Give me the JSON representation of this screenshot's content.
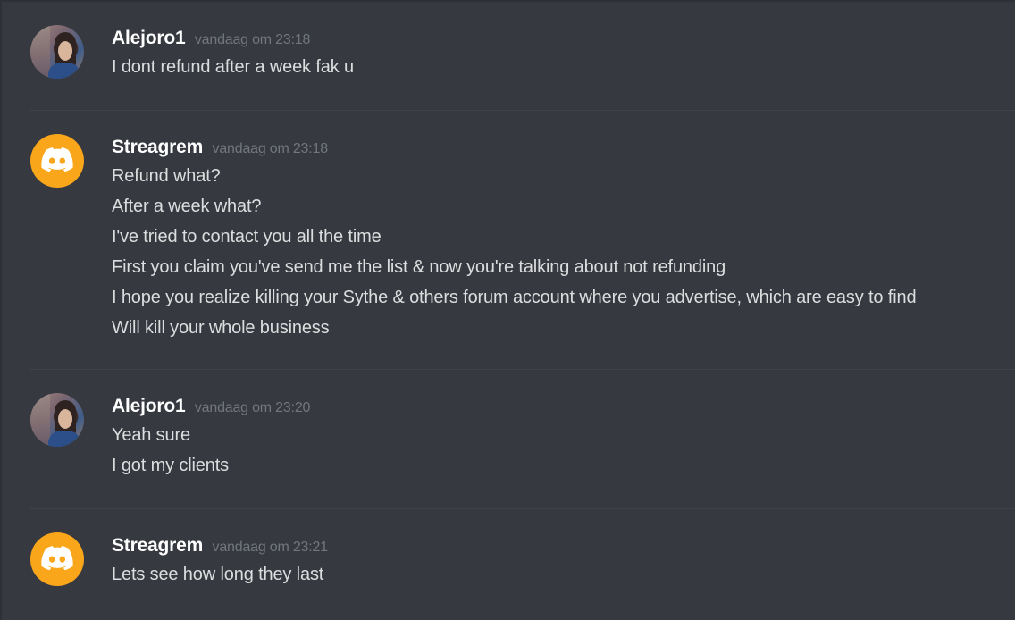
{
  "messages": [
    {
      "author": "Alejoro1",
      "timestamp": "vandaag om 23:18",
      "avatar": "user-photo-avatar",
      "lines": [
        "I dont refund after a week fak u"
      ]
    },
    {
      "author": "Streagrem",
      "timestamp": "vandaag om 23:18",
      "avatar": "discord-default-avatar",
      "avatar_color": "#faa61a",
      "lines": [
        "Refund what?",
        "After a week what?",
        "I've tried to contact you all the time",
        "First you claim you've send me the list & now you're talking about not refunding",
        "I hope you realize killing your Sythe & others forum account where you advertise, which are easy to find",
        "Will kill your whole business"
      ]
    },
    {
      "author": "Alejoro1",
      "timestamp": "vandaag om 23:20",
      "avatar": "user-photo-avatar",
      "lines": [
        "Yeah sure",
        "I got my clients"
      ]
    },
    {
      "author": "Streagrem",
      "timestamp": "vandaag om 23:21",
      "avatar": "discord-default-avatar",
      "avatar_color": "#faa61a",
      "lines": [
        "Lets see how long they last"
      ]
    }
  ],
  "colors": {
    "background": "#36393f",
    "username": "#ffffff",
    "timestamp": "#72767d",
    "text": "#dcddde",
    "divider": "#40434a"
  }
}
